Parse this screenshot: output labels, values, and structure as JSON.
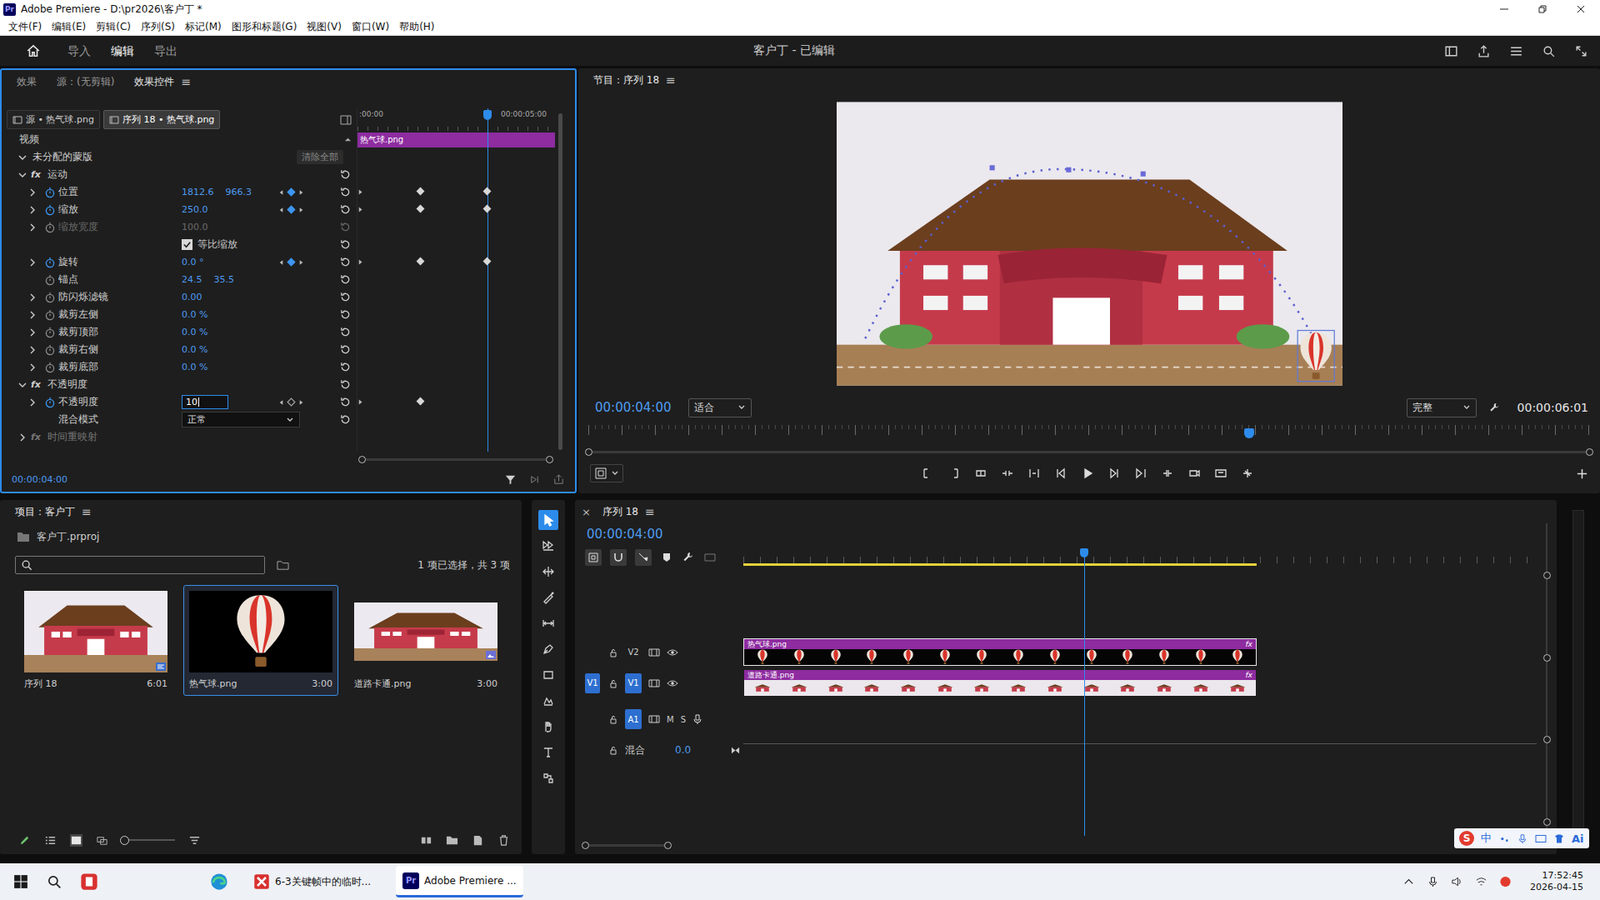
{
  "window": {
    "title": "Adobe Premiere - D:\\pr2026\\客户丁 *",
    "logo": "Pr"
  },
  "menu": [
    "文件(F)",
    "编辑(E)",
    "剪辑(C)",
    "序列(S)",
    "标记(M)",
    "图形和标题(G)",
    "视图(V)",
    "窗口(W)",
    "帮助(H)"
  ],
  "header": {
    "workspaces": [
      {
        "label": "导入",
        "selected": false
      },
      {
        "label": "编辑",
        "selected": true
      },
      {
        "label": "导出",
        "selected": false
      }
    ],
    "title": "客户丁 - 已编辑"
  },
  "effect_controls": {
    "tabs": [
      {
        "label": "效果",
        "selected": false
      },
      {
        "label": "源：(无剪辑)",
        "selected": false
      },
      {
        "label": "效果控件",
        "selected": true
      }
    ],
    "menu_glyph": "≡",
    "sources": [
      {
        "label": "源 • 热气球.png",
        "selected": false
      },
      {
        "label": "序列 18 • 热气球.png",
        "selected": true
      }
    ],
    "ruler": [
      ":00:00",
      "00:00:05:00"
    ],
    "clip": "热气球.png",
    "playhead": {
      "level": 0.66
    },
    "rows": [
      {
        "kind": "section",
        "label": "视频"
      },
      {
        "kind": "mask",
        "label": "未分配的蒙版",
        "button": "清除全部",
        "expanded": true
      },
      {
        "kind": "effect",
        "label": "运动",
        "fx": "fx",
        "expanded": true,
        "disabled": false
      },
      {
        "kind": "param",
        "label": "位置",
        "values": [
          "1812.6",
          "966.3"
        ],
        "expandable": true,
        "animated": true,
        "at_keyframe": true,
        "disabled": false,
        "keyframes": [
          0.32,
          0.66
        ]
      },
      {
        "kind": "param",
        "label": "缩放",
        "values": [
          "250.0"
        ],
        "expandable": true,
        "animated": true,
        "at_keyframe": true,
        "disabled": false,
        "keyframes": [
          0.32,
          0.66
        ]
      },
      {
        "kind": "param",
        "label": "缩放宽度",
        "values": [
          "100.0"
        ],
        "expandable": true,
        "animated": false,
        "at_keyframe": false,
        "disabled": true,
        "keyframes": []
      },
      {
        "kind": "checkbox",
        "label": "等比缩放",
        "checked": true
      },
      {
        "kind": "param",
        "label": "旋转",
        "values": [
          "0.0 °"
        ],
        "expandable": true,
        "animated": true,
        "at_keyframe": true,
        "disabled": false,
        "keyframes": [
          0.32,
          0.66
        ]
      },
      {
        "kind": "param",
        "label": "锚点",
        "values": [
          "24.5",
          "35.5"
        ],
        "expandable": false,
        "animated": false,
        "at_keyframe": false,
        "disabled": false,
        "keyframes": []
      },
      {
        "kind": "param",
        "label": "防闪烁滤镜",
        "values": [
          "0.00"
        ],
        "expandable": true,
        "animated": false,
        "at_keyframe": false,
        "disabled": false,
        "keyframes": []
      },
      {
        "kind": "param",
        "label": "裁剪左侧",
        "values": [
          "0.0 %"
        ],
        "expandable": true,
        "animated": false,
        "at_keyframe": false,
        "disabled": false,
        "keyframes": []
      },
      {
        "kind": "param",
        "label": "裁剪顶部",
        "values": [
          "0.0 %"
        ],
        "expandable": true,
        "animated": false,
        "at_keyframe": false,
        "disabled": false,
        "keyframes": []
      },
      {
        "kind": "param",
        "label": "裁剪右侧",
        "values": [
          "0.0 %"
        ],
        "expandable": true,
        "animated": false,
        "at_keyframe": false,
        "disabled": false,
        "keyframes": []
      },
      {
        "kind": "param",
        "label": "裁剪底部",
        "values": [
          "0.0 %"
        ],
        "expandable": true,
        "animated": false,
        "at_keyframe": false,
        "disabled": false,
        "keyframes": []
      },
      {
        "kind": "effect",
        "label": "不透明度",
        "fx": "fx",
        "expanded": true,
        "disabled": false
      },
      {
        "kind": "input",
        "label": "不透明度",
        "value": "10",
        "expandable": true,
        "animated": true,
        "at_keyframe": false,
        "keyframes": [
          0.32
        ]
      },
      {
        "kind": "select",
        "label": "混合模式",
        "value": "正常"
      },
      {
        "kind": "effect",
        "label": "时间重映射",
        "fx": "fx",
        "expanded": false,
        "disabled": true
      }
    ],
    "timecode": "00:00:04:00"
  },
  "program": {
    "title": "节目：序列 18",
    "menu_glyph": "≡",
    "timecode": "00:00:04:00",
    "zoom": "适合",
    "quality": "完整",
    "duration": "00:00:06:01",
    "playhead": {
      "level": 0.66
    }
  },
  "project": {
    "title": "项目：客户丁",
    "menu_glyph": "≡",
    "file": "客户丁.prproj",
    "count": "1 项已选择，共 3 项",
    "items": [
      {
        "name": "序列 18",
        "duration": "6:01",
        "selected": false,
        "kind": "sequence"
      },
      {
        "name": "热气球.png",
        "duration": "3:00",
        "selected": true,
        "kind": "balloon"
      },
      {
        "name": "道路卡通.png",
        "duration": "3:00",
        "selected": false,
        "kind": "school"
      }
    ]
  },
  "tools": [
    {
      "kind": "select",
      "selected": true
    },
    {
      "kind": "track",
      "selected": false
    },
    {
      "kind": "ripple",
      "selected": false
    },
    {
      "kind": "razor",
      "selected": false
    },
    {
      "kind": "slip",
      "selected": false
    },
    {
      "kind": "pen",
      "selected": false
    },
    {
      "kind": "rect",
      "selected": false
    },
    {
      "kind": "remix",
      "selected": false
    },
    {
      "kind": "hand",
      "selected": false
    },
    {
      "kind": "type",
      "selected": false
    },
    {
      "kind": "extra",
      "selected": false
    }
  ],
  "timeline": {
    "close": "×",
    "title": "序列 18",
    "menu_glyph": "≡",
    "timecode": "00:00:04:00",
    "playhead": {
      "level": 0.43
    },
    "work_area": {
      "level": 0.647
    },
    "tracks": [
      {
        "kind": "video",
        "label": "V2",
        "patch": "",
        "targeted": false,
        "clip": {
          "label": "热气球.png",
          "fx": "fx",
          "thumb": "balloon",
          "level": 0.647,
          "selected": true
        }
      },
      {
        "kind": "video",
        "label": "V1",
        "patch": "V1",
        "targeted": true,
        "clip": {
          "label": "道路卡通.png",
          "fx": "fx",
          "thumb": "school",
          "level": 0.647,
          "selected": false
        }
      },
      {
        "kind": "audio",
        "label": "A1",
        "targeted": true,
        "buttons": [
          "M",
          "S"
        ]
      },
      {
        "kind": "mix",
        "label": "混合",
        "value": "0.0"
      }
    ]
  },
  "ime_bar": {
    "logo": "S",
    "items": [
      "中",
      "Ai"
    ]
  },
  "taskbar": {
    "apps": [
      {
        "label": "6-3关键帧中的临时...",
        "active": false
      },
      {
        "label": "Adobe Premiere ...",
        "active": true
      }
    ],
    "time": "17:52:45",
    "date": "2026-04-15"
  }
}
